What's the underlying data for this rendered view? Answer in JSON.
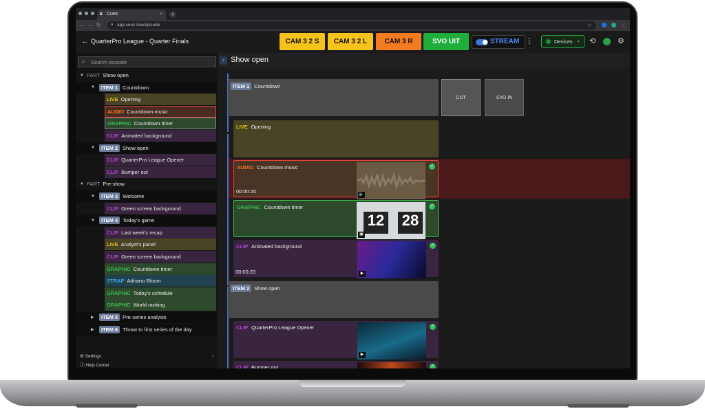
{
  "browser": {
    "tab_title": "Cuez",
    "url": "app.cuez.live/episode"
  },
  "header": {
    "episode_title": "QuarterPro League - Quarter Finals",
    "buttons": [
      {
        "label": "CAM 3 2 S",
        "color": "#f6c21c"
      },
      {
        "label": "CAM 3 2 L",
        "color": "#f6c21c"
      },
      {
        "label": "CAM 3 R",
        "color": "#f47c20"
      },
      {
        "label": "SVO UIT",
        "color": "#1fae3c"
      }
    ],
    "stream_label": "STREAM",
    "devices_label": "Devices"
  },
  "sidebar": {
    "search_placeholder": "Search episode",
    "settings_label": "Settings",
    "help_label": "Help Center",
    "rows": [
      {
        "kind": "part",
        "label": "PART",
        "text": "Show open"
      },
      {
        "kind": "item",
        "label": "ITEM 1",
        "text": "Countdown"
      },
      {
        "kind": "cue",
        "label": "LIVE",
        "text": "Opening",
        "color": "#e2c019",
        "bg": "#4a4426"
      },
      {
        "kind": "cue",
        "label": "AUDIO",
        "text": "Countdown music",
        "color": "#f47c20",
        "bg": "#4a2b22",
        "selected": true
      },
      {
        "kind": "cue",
        "label": "GRAPHIC",
        "text": "Countdown timer",
        "color": "#3dbb4f",
        "bg": "#2d4a2d",
        "outlined": true
      },
      {
        "kind": "cue",
        "label": "CLIP",
        "text": "Animated background",
        "color": "#b24ad6",
        "bg": "#3a2540"
      },
      {
        "kind": "item",
        "label": "ITEM 2",
        "text": "Show open"
      },
      {
        "kind": "cue",
        "label": "CLIP",
        "text": "QuarterPro League Opener",
        "color": "#b24ad6",
        "bg": "#3a2540"
      },
      {
        "kind": "cue",
        "label": "CLIP",
        "text": "Bumper out",
        "color": "#b24ad6",
        "bg": "#3a2540"
      },
      {
        "kind": "part",
        "label": "PART",
        "text": "Pre-show"
      },
      {
        "kind": "item",
        "label": "ITEM 3",
        "text": "Welcome"
      },
      {
        "kind": "cue",
        "label": "CLIP",
        "text": "Green screen background",
        "color": "#b24ad6",
        "bg": "#3a2540"
      },
      {
        "kind": "item",
        "label": "ITEM 4",
        "text": "Today's game"
      },
      {
        "kind": "cue",
        "label": "CLIP",
        "text": "Last week's recap",
        "color": "#b24ad6",
        "bg": "#3a2540"
      },
      {
        "kind": "cue",
        "label": "LIVE",
        "text": "Analyst's panel",
        "color": "#e2c019",
        "bg": "#4a4426"
      },
      {
        "kind": "cue",
        "label": "CLIP",
        "text": "Green screen background",
        "color": "#b24ad6",
        "bg": "#3a2540"
      },
      {
        "kind": "cue",
        "label": "GRAPHIC",
        "text": "Countdown timer",
        "color": "#3dbb4f",
        "bg": "#2d4a2d"
      },
      {
        "kind": "cue",
        "label": "STRAP",
        "text": "Adriano Bloom",
        "color": "#3ea6e0",
        "bg": "#22414e"
      },
      {
        "kind": "cue",
        "label": "GRAPHIC",
        "text": "Today's schedule",
        "color": "#3dbb4f",
        "bg": "#2d4a2d"
      },
      {
        "kind": "cue",
        "label": "GRAPHIC",
        "text": "World ranking",
        "color": "#3dbb4f",
        "bg": "#2d4a2d"
      },
      {
        "kind": "item-collapsed",
        "label": "ITEM 5",
        "text": "Pre-series analysis"
      },
      {
        "kind": "item-collapsed",
        "label": "ITEM 6",
        "text": "Throw to first series of the day"
      }
    ]
  },
  "main": {
    "title": "Show open",
    "item1": {
      "label": "ITEM 1",
      "text": "Countdown"
    },
    "cut_label": "CUT",
    "svo_in_label": "SVO IN",
    "cards": [
      {
        "label": "LIVE",
        "text": "Opening",
        "color": "#e2c019",
        "bg": "#4a4426",
        "time": ""
      },
      {
        "label": "AUDIO",
        "text": "Countdown music",
        "color": "#f47c20",
        "bg": "#4a3426",
        "time": "00:00:20"
      },
      {
        "label": "GRAPHIC",
        "text": "Countdown timer",
        "color": "#3dbb4f",
        "bg": "#2d4a2d",
        "time": ""
      },
      {
        "label": "CLIP",
        "text": "Animated background",
        "color": "#b24ad6",
        "bg": "#3a2540",
        "time": "00:00:20"
      }
    ],
    "item2": {
      "label": "ITEM 2",
      "text": "Show open"
    },
    "cards2": [
      {
        "label": "CLIP",
        "text": "QuarterPro League Opener",
        "color": "#b24ad6",
        "bg": "#3a2540",
        "time": ""
      },
      {
        "label": "CLIP",
        "text": "Bumper out",
        "color": "#b24ad6",
        "bg": "#3a2540",
        "time": ""
      }
    ],
    "timer_digits": [
      "12",
      "28"
    ]
  }
}
